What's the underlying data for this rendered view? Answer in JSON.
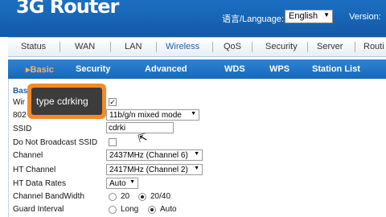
{
  "header": {
    "logo": "3G Router",
    "language_label": "语言/Language:",
    "language_value": "English",
    "version_label": "Version:"
  },
  "main_nav": [
    "Status",
    "WAN",
    "LAN",
    "Wireless",
    "QoS",
    "Security",
    "Server",
    "Routi"
  ],
  "sub_nav": {
    "basic": "Basic",
    "security": "Security",
    "advanced": "Advanced",
    "wds": "WDS",
    "wps": "WPS",
    "station_list": "Station List"
  },
  "section_title": "Bas",
  "form": {
    "wireless_label": "Wir",
    "mode_label": "802",
    "mode_value": "11b/g/n mixed mode",
    "ssid_label": "SSID",
    "ssid_value": "cdrki",
    "broadcast_label": "Do Not Broadcast SSID",
    "channel_label": "Channel",
    "channel_value": "2437MHz (Channel 6)",
    "ht_channel_label": "HT Channel",
    "ht_channel_value": "2417MHz (Channel 2)",
    "ht_rates_label": "HT Data Rates",
    "ht_rates_value": "Auto",
    "bandwidth_label": "Channel BandWidth",
    "bandwidth_opt1": "20",
    "bandwidth_opt2": "20/40",
    "guard_label": "Guard Interval",
    "guard_opt1": "Long",
    "guard_opt2": "Auto"
  },
  "callout": "type cdrking",
  "colors": {
    "header_blue": "#1c6fc2",
    "subnav_blue": "#1f74c8",
    "active_tab": "#ffb25a",
    "callout_orange": "#f48a2a",
    "callout_dark": "#3c3c3c"
  }
}
